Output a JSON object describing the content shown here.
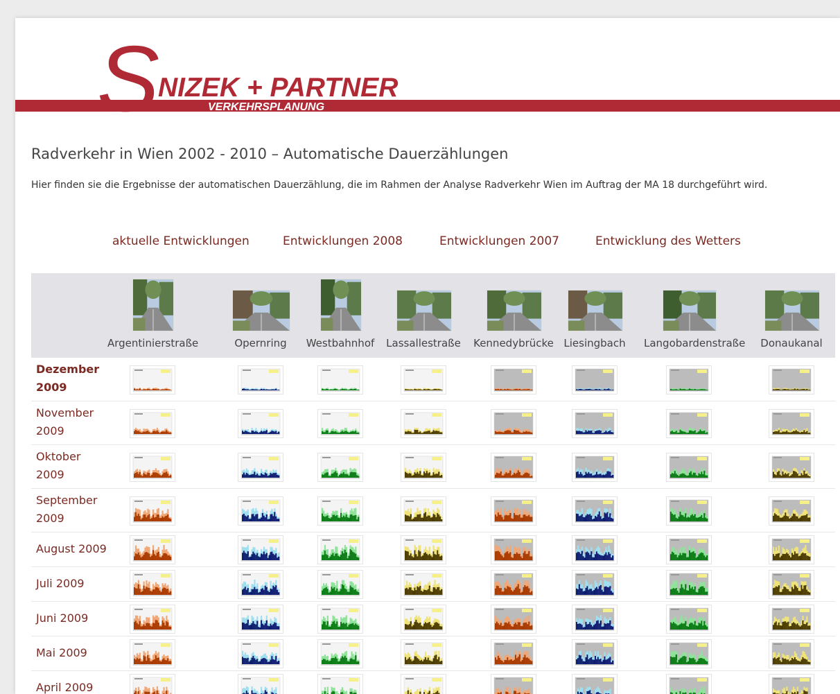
{
  "brand": {
    "name": "NIZEK + PARTNER",
    "initial": "S",
    "sub": "VERKEHRSPLANUNG",
    "color": "#b02a36"
  },
  "heading": "Radverkehr in Wien 2002 - 2010 – Automatische Dauerzählungen",
  "intro": "Hier finden sie die Ergebnisse der automatischen Dauerzählung, die im Rahmen der Analyse Radverkehr Wien im Auftrag der MA 18 durchgeführt wird.",
  "nav": [
    "aktuelle Entwicklungen",
    "Entwicklungen 2008",
    "Entwicklungen 2007",
    "Entwicklung des Wetters"
  ],
  "sites": [
    {
      "label": "Argentinierstraße",
      "fg": "#a83a00",
      "fill": "#f0a878",
      "photo": "street-tall"
    },
    {
      "label": "Opernring",
      "fg": "#0e1a6e",
      "fill": "#9fdff0",
      "photo": "street-trees"
    },
    {
      "label": "Westbahnhof",
      "fg": "#0a7a14",
      "fill": "#90e39a",
      "photo": "street-tall"
    },
    {
      "label": "Lassallestraße",
      "fg": "#4a3a00",
      "fill": "#efe37a",
      "photo": "wide-road"
    },
    {
      "label": "Kennedybrücke",
      "fg": "#a83a00",
      "fill": "#f0a878",
      "photo": "wide-trees"
    },
    {
      "label": "Liesingbach",
      "fg": "#0e1a6e",
      "fill": "#9fdff0",
      "photo": "wide-path"
    },
    {
      "label": "Langobardenstraße",
      "fg": "#0a7a14",
      "fill": "#90e39a",
      "photo": "wide-sky"
    },
    {
      "label": "Donaukanal",
      "fg": "#4a3a00",
      "fill": "#efe37a",
      "photo": "wide-canal"
    }
  ],
  "months": [
    {
      "label": "Dezember 2009",
      "bold": true
    },
    {
      "label": "November 2009",
      "bold": false
    },
    {
      "label": "Oktober 2009",
      "bold": false
    },
    {
      "label": "September 2009",
      "bold": false
    },
    {
      "label": "August 2009",
      "bold": false
    },
    {
      "label": "Juli 2009",
      "bold": false
    },
    {
      "label": "Juni 2009",
      "bold": false
    },
    {
      "label": "Mai 2009",
      "bold": false
    },
    {
      "label": "April 2009",
      "bold": false
    }
  ],
  "gray_sites": [
    4,
    5,
    6,
    7
  ]
}
